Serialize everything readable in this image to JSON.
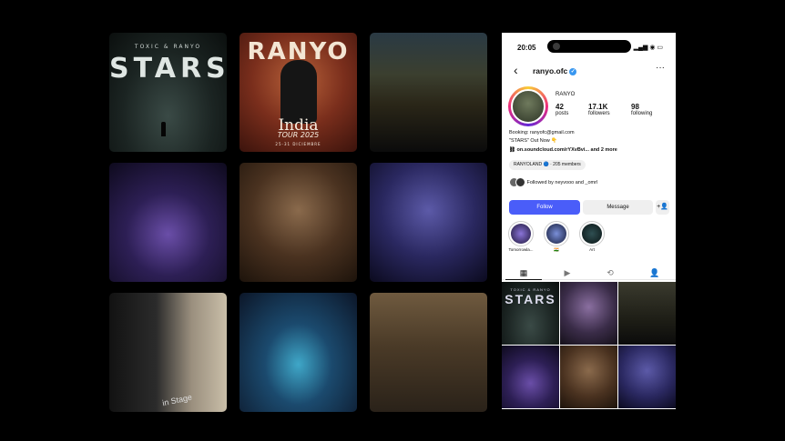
{
  "feed_grid": {
    "tile1": {
      "small": "TOXIC & RANYO",
      "title": "STARS"
    },
    "tile2": {
      "title": "RANYO",
      "india": "India",
      "tour": "TOUR 2025",
      "dates": "25-31 DICIEMBRE"
    },
    "tile7": {
      "sign": "in Stage"
    }
  },
  "phone": {
    "status": {
      "time": "20:05",
      "icons": "▂▄▆ ◉ ▭"
    },
    "header": {
      "back": "‹",
      "username": "ranyo.ofc",
      "verified": "✓",
      "more": "···"
    },
    "profile": {
      "name": "RANYO",
      "stats": [
        {
          "value": "42",
          "label": "posts"
        },
        {
          "value": "17.1K",
          "label": "followers"
        },
        {
          "value": "98",
          "label": "following"
        }
      ],
      "bio_line1": "Booking: ranyofc@gmail.com",
      "bio_line2": "\"STARS\" Out Now 👇",
      "bio_link": "on.soundcloud.com/rYXvBvi...",
      "bio_more": "and 2 more",
      "channel": "RANYOLAND 🔵 · 205 members",
      "followed_by": "Followed by neyvooo and _omrl"
    },
    "buttons": {
      "follow": "Follow",
      "message": "Message",
      "add_user": "+👤"
    },
    "highlights": [
      {
        "label": "Tomorrowla..."
      },
      {
        "label": "🇮🇳"
      },
      {
        "label": "Art"
      }
    ],
    "tabs": {
      "grid": "▦",
      "reels": "▶",
      "reposts": "⟲",
      "tagged": "👤"
    },
    "post_grid": {
      "p1_small": "TOXIC & RANYO",
      "p1_title": "STARS"
    }
  },
  "colors": {
    "background": "#000000",
    "follow_button": "#4a5df9",
    "verified": "#3897f0"
  }
}
